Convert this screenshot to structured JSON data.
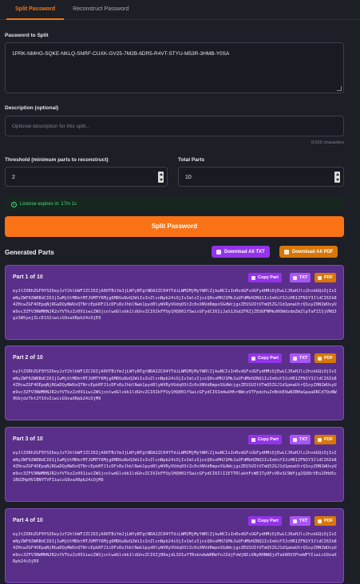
{
  "tabs": [
    {
      "label": "Split Password",
      "active": true
    },
    {
      "label": "Reconstruct Password",
      "active": false
    }
  ],
  "password": {
    "label": "Password to Split",
    "value": "1PRK-NMHG-SQKE-NKLQ-SNRF-CUXK-GV25-7M2B-6DR5-R4VT-STYU-M53R-3HMB-Y0SA"
  },
  "description": {
    "label": "Description (optional)",
    "placeholder": "Optional description for this split...",
    "counter": "0/100 characters"
  },
  "threshold": {
    "label": "Threshold (minimum parts to reconstruct)",
    "value": "2"
  },
  "total_parts": {
    "label": "Total Parts",
    "value": "10"
  },
  "license": {
    "text": "License expires in: 17m 1s"
  },
  "split_button": "Split Password",
  "generated": {
    "title": "Generated Parts",
    "download_txt": "Download All TXT",
    "download_pdf": "Download All PDF"
  },
  "part_buttons": {
    "copy": "Copy Part",
    "txt": "TXT",
    "pdf": "PDF"
  },
  "parts": [
    {
      "title": "Part 1 of 10",
      "code": "eyJtZXRhZGF0YSI6eyJzY2hlbWFJZCI6IjA0OTBiYmJjLWYyNTgtNDA2ZC04YTdiLWM2MjMyYWRlZjkwNCIsInRvdGFsUGFydHMiOjEwLCJ0aHJlc2hvbGQiOjIsImNyZWF0ZWRBdCI6IjIwMjUtMDktMTJUMTY6Mjg6MDUuNzQ2WiIsInZlcnNpb24iOjIsImlzIjoiQ0sxMHJ1MkJuUFdMbHZNQ1IsImVuY3JcHR1ZFN1Y3JldCI6Ik84ZHcwZGF4OEpqNjRGaDQyNWUxQTNrcEpkRFJ1cDFsRzJhblNwb1pyd0lyWVRyVUdqOStZc0xXNVdRmpoSGdWcjgxZEUSUItUTmQ5ZGJ1d1pmaUtrQ1oyZ0N1WUxyUm9vc3ZFV3NWMHNJR2xYVTkzZz091iwiZWSjcnlwdGlvbk1ldGhvZCI6IkFFUy1HQ001fSwicGFydCI6IjJaS12Gd2FRZjZEUUFNMkd0OWdzdmZmZlpTaFZ1SjVNQ3gzSW5yejZLcE1SIiwicG9zaXRpb24iOjE9"
    },
    {
      "title": "Part 2 of 10",
      "code": "eyJtZXRhZGF0YSI6eyJzY2hlbWFJZCI6IjA0OTBiYmJjLWYyNTgtNDA2ZC04YTdiLWM2MjMyYWRlZjkwNCIsInRvdGFsUGFydHMiOjEwLCJ0aHJlc2hvbGQiOjIsImNyZWF0ZWRBdCI6IjIwMjUtMDktMTJUMTY6Mjg6MDUuNzQ2WiIsInZlcnNpb24iOjIsImlzIjoiQ0sxMHJ1MkJuUFdMbHZNQ1IsImVuY3JcHR1ZFN1Y3JldCI6Ik84ZHcwZGF4OEpqNjRGaDQyNWUxQTNrcEpkRFJ1cDFsRzJhblNwb1pyd0lyWVRyVUdqOStZc0xXNVdRmpoSGdWcjgxZEUSUItUTmQ5ZGJ1d1pmaUtrQ1oyZ0N1WUxyUm9vc3ZFV3NWMHNJR2xYVTkzZz091iwiZWSjcnlwdGlvbk1ldGhvZCI6IkFFUy1HQ001fSwicGFydCI6Im4wUHhrNWczVTFpdzhuZnBnbE9wN3BHaGpaaDRCdTQxNW9UbjdzTkt2Y1VvIiwicG9zaXRpb24iOjM9"
    },
    {
      "title": "Part 3 of 10",
      "code": "eyJtZXRhZGF0YSI6eyJzY2hlbWFJZCI6IjA0OTBiYmJjLWYyNTgtNDA2ZC04YTdiLWM2MjMyYWRlZjkwNCIsInRvdGFsUGFydHMiOjEwLCJ0aHJlc2hvbGQiOjIsImNyZWF0ZWRBdCI6IjIwMjUtMDktMTJUMTY6Mjg6MDUuNzQ2WiIsInZlcnNpb24iOjIsImlzIjoiQ0sxMHJ1MkJuUFdMbHZNQ1IsImVuY3JcHR1ZFN1Y3JldCI6Ik84ZHcwZGF4OEpqNjRGaDQyNWUxQTNrcEpkRFJ1cDFsRzJhblNwb1pyd0lyWVRyVUdqOStZc0xXNVdRmpoSGdWcjgxZEUSUItUTmQ5ZGJ1d1pmaUtrQ1oyZ0N1WUxyUm9vc3ZFV3NWMHNJR2xYVTkzZz091iwiZWSjcnlwdGlvbk1ldGhvZCI6IkFFUy1HQ001fSwicGFydCI6IlI1ETTRlakhFcWE1Ty9FcVRsSC9WYjg2QU8rVEo2OHd5c1BUZHpHV1BNYTVFIiwicG9zaXRpb24iOjM9"
    },
    {
      "title": "Part 4 of 10",
      "code": "eyJtZXRhZGF0YSI6eyJzY2hlbWFJZCI6IjA0OTBiYmJjLWYyNTgtNDA2ZC04YTdiLWM2MjMyYWRlZjkwNCIsInRvdGFsUGFydHMiOjEwLCJ0aHJlc2hvbGQiOjIsImNyZWF0ZWRBdCI6IjIwMjUtMDktMTJUMTY6Mjg6MDUuNzQ2WiIsInZlcnNpb24iOjIsImlzIjoiQ0sxMHJ1MkJuUFdMbHZNQ1IsImVuY3JcHR1ZFN1Y3JldCI6Ik84ZHcwZGF4OEpqNjRGaDQyNWUxQTNrcEpkRFJ1cDFsRzJhblNwb1pyd0lyWVRyVUdqOStZc0xXNVdRmpoSGdWcjgxZEUSUItUTmQ5ZGJ1d1pmaUtrQ1oyZ0N1WUxyUm9vc3ZFV3NWMHNJR2xYVTkzZz091iwiZWSjcnlwdGlvbk1ldGhvZCI6IjB0ajdLSU1uYTRvbndwWHRmYnJZdjFoWjNIcXNyRHNWQjdTak80V3FheWFYIiwicG9zaXRpb24iOjR9"
    }
  ],
  "colors": {
    "accent": "#f97316",
    "part_bg": "#5a2f8a",
    "license": "#4ade80",
    "pdf": "#d97706",
    "txt": "#a855f7"
  }
}
